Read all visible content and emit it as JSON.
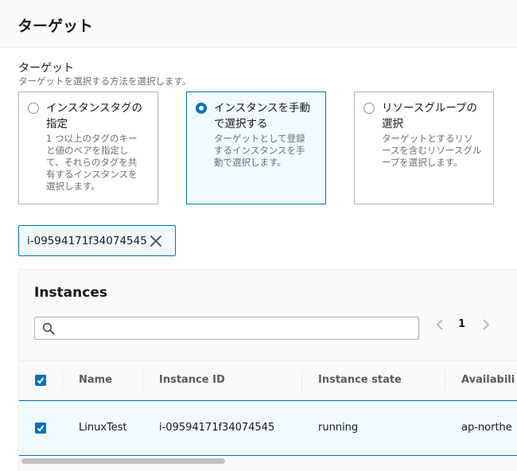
{
  "section": {
    "title": "ターゲット"
  },
  "field": {
    "label": "ターゲット",
    "description": "ターゲットを選択する方法を選択します。"
  },
  "options": [
    {
      "title_line1": "インスタンスタグの",
      "title_line2": "指定",
      "desc_lines": [
        "1 つ以上のタグのキー",
        "と値のペアを指定し",
        "て、それらのタグを共",
        "有するインスタンスを",
        "選択します。"
      ],
      "selected": false
    },
    {
      "title_line1": "インスタンスを手動",
      "title_line2": "で選択する",
      "desc_lines": [
        "ターゲットとして登録",
        "するインスタンスを手",
        "動で選択します。"
      ],
      "selected": true
    },
    {
      "title_line1": "リソースグループの",
      "title_line2": "選択",
      "desc_lines": [
        "ターゲットとするリソ",
        "ースを含むリソースグル",
        "ープを選択します。"
      ],
      "selected": false
    }
  ],
  "token": {
    "label": "i-09594171f34074545"
  },
  "instances": {
    "title": "Instances",
    "search": {
      "value": "",
      "placeholder": ""
    },
    "pagination": {
      "current_page": "1"
    },
    "columns": [
      "Name",
      "Instance ID",
      "Instance state",
      "Availabili"
    ],
    "rows": [
      {
        "name": "LinuxTest",
        "instance_id": "i-09594171f34074545",
        "state": "running",
        "az": "ap-northe",
        "checked": true
      }
    ]
  },
  "colors": {
    "accent": "#0073bb",
    "selected_bg": "#f1faff",
    "border": "#aab7b8",
    "muted_text": "#687078"
  }
}
